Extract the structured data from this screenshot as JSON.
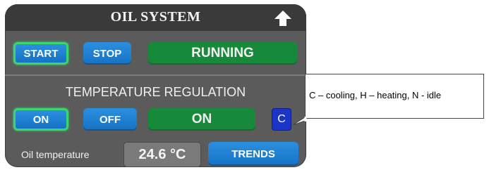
{
  "panel": {
    "title": "OIL SYSTEM",
    "controls": {
      "start_label": "START",
      "stop_label": "STOP",
      "status": "RUNNING"
    },
    "temperature_regulation": {
      "title": "TEMPERATURE REGULATION",
      "on_label": "ON",
      "off_label": "OFF",
      "status": "ON",
      "mode": "C"
    },
    "oil_temperature": {
      "label": "Oil temperature",
      "value": "24.6 °C",
      "trends_label": "TRENDS"
    }
  },
  "callout": {
    "text": "C – cooling, H – heating, N - idle"
  },
  "colors": {
    "panel_bg": "#5b5b5b",
    "header_bg": "#3a3a3a",
    "button_blue": "#1a7fd4",
    "active_border": "#39d66b",
    "status_green": "#168a3a",
    "mode_blue": "#1a35c7",
    "value_bg": "#7a7a7a"
  },
  "icons": {
    "header_arrow": "up-arrow-icon"
  }
}
